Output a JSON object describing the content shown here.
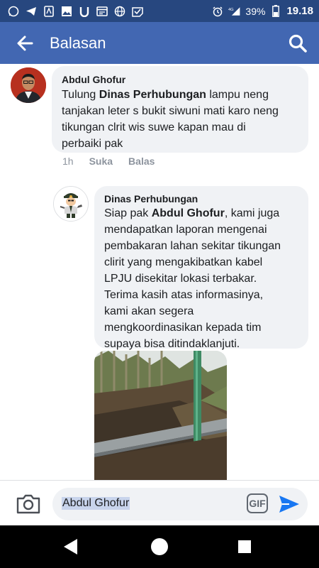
{
  "status_bar": {
    "battery": "39%",
    "time": "19.18",
    "network": "4G"
  },
  "header": {
    "title": "Balasan"
  },
  "comments": [
    {
      "author": "Abdul Ghofur",
      "text_lines": [
        "Tulung ",
        "Dinas Perhubungan",
        " lampu neng",
        "tanjakan leter s bukit siwuni mati karo neng",
        "tikungan clrit wis suwe kapan mau di",
        "perbaiki pak"
      ],
      "time": "1h",
      "like_label": "Suka",
      "reply_label": "Balas"
    },
    {
      "author": "Dinas Perhubungan",
      "text_lines": [
        "Siap pak ",
        "Abdul Ghofur",
        ", kami juga",
        "mendapatkan laporan mengenai",
        "pembakaran lahan sekitar tikungan",
        "clirit yang mengakibatkan kabel",
        "LPJU disekitar lokasi terbakar.",
        "Terima kasih atas informasinya,",
        "kami akan segera",
        "mengkoordinasikan kepada tim",
        "supaya bisa ditindaklanjuti."
      ]
    }
  ],
  "composer": {
    "value": "Abdul Ghofur",
    "gif_label": "GIF"
  },
  "colors": {
    "header_bg": "#4267b2",
    "status_bg": "#27477f",
    "accent": "#1877f2"
  }
}
